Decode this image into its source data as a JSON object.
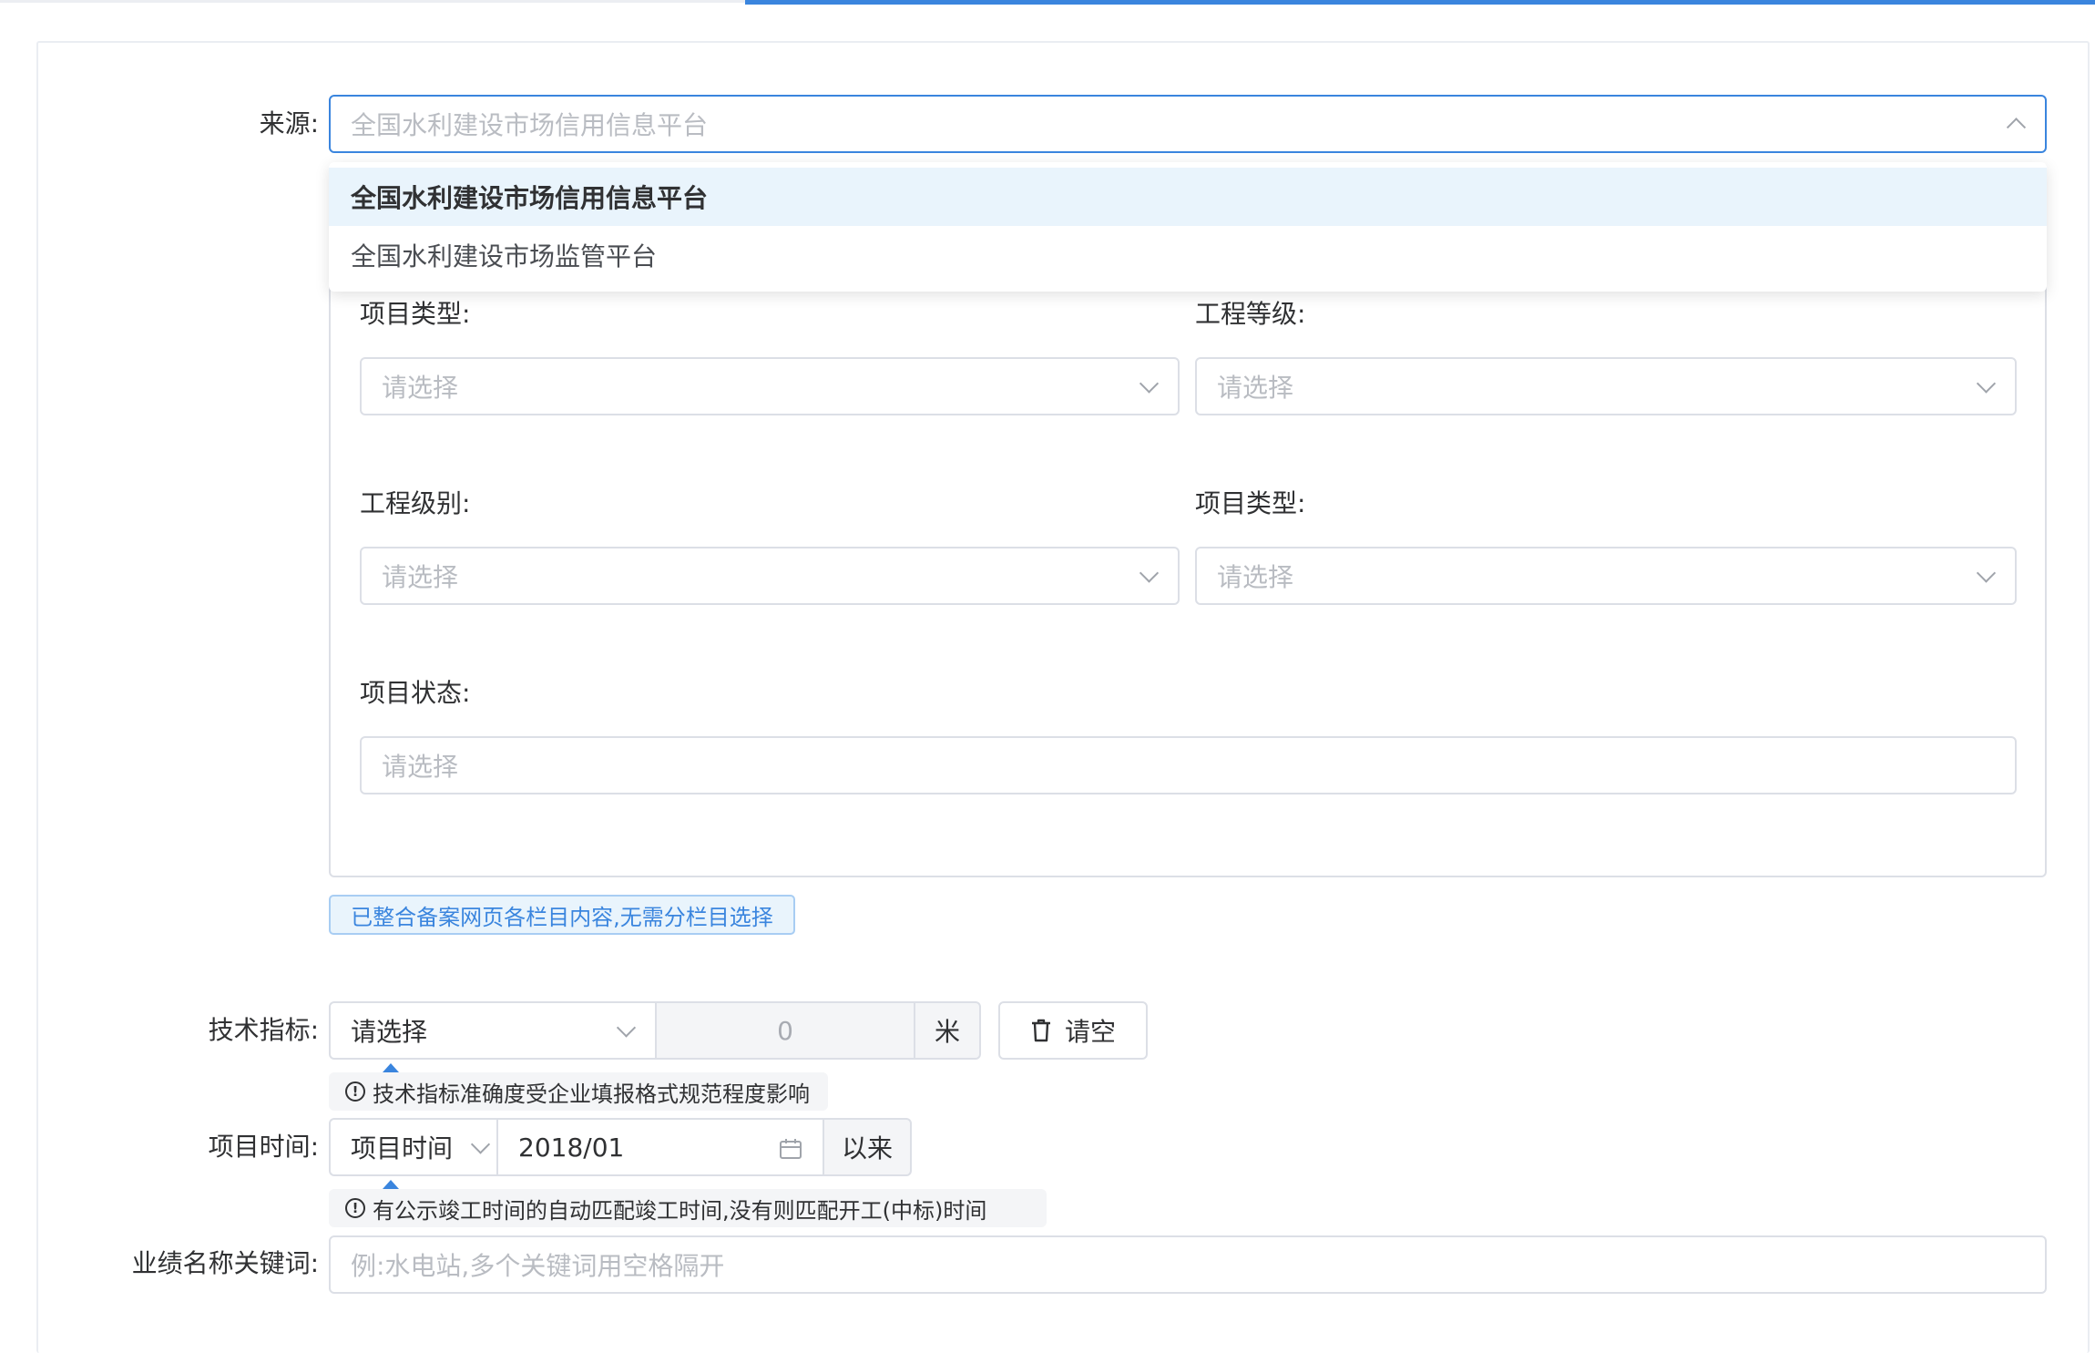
{
  "source": {
    "label": "来源:",
    "selected": "全国水利建设市场信用信息平台",
    "options": [
      "全国水利建设市场信用信息平台",
      "全国水利建设市场监管平台"
    ]
  },
  "filters": {
    "project_type_a": {
      "label": "项目类型:",
      "placeholder": "请选择"
    },
    "engineering_grade": {
      "label": "工程等级:",
      "placeholder": "请选择"
    },
    "engineering_level": {
      "label": "工程级别:",
      "placeholder": "请选择"
    },
    "project_type_b": {
      "label": "项目类型:",
      "placeholder": "请选择"
    },
    "project_status": {
      "label": "项目状态:",
      "placeholder": "请选择"
    }
  },
  "notice_tag": "已整合备案网页各栏目内容,无需分栏目选择",
  "tech": {
    "label": "技术指标:",
    "select": "请选择",
    "number": "0",
    "unit": "米",
    "clear": "请空",
    "tip": "技术指标准确度受企业填报格式规范程度影响"
  },
  "time": {
    "label": "项目时间:",
    "select": "项目时间",
    "date": "2018/01",
    "suffix": "以来",
    "tip": "有公示竣工时间的自动匹配竣工时间,没有则匹配开工(中标)时间"
  },
  "keyword": {
    "label": "业绩名称关键词:",
    "placeholder": "例:水电站,多个关键词用空格隔开"
  },
  "colors": {
    "accent": "#3a85de",
    "border": "#dcdfe6",
    "placeholder": "#b9bcc2"
  }
}
